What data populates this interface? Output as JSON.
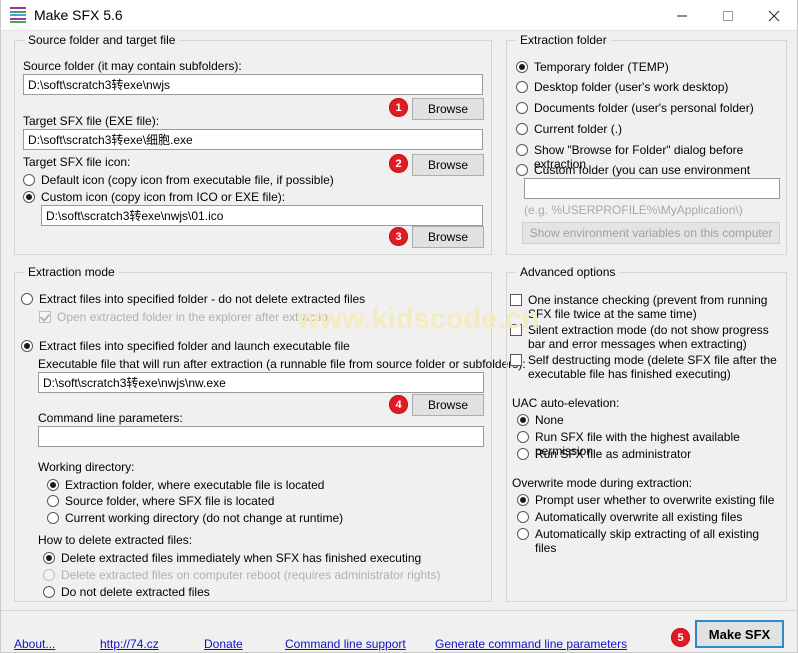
{
  "window": {
    "title": "Make SFX 5.6",
    "icon": "stacked-bars-icon",
    "minimize": "─",
    "maximize": "□",
    "close": "✕"
  },
  "source_group": {
    "legend": "Source folder and target file",
    "source_label": "Source folder (it may contain subfolders):",
    "source_value": "D:\\soft\\scratch3转exe\\nwjs",
    "browse1": "Browse",
    "target_label": "Target SFX file (EXE file):",
    "target_value": "D:\\soft\\scratch3转exe\\细胞.exe",
    "icon_label": "Target SFX file icon:",
    "browse2": "Browse",
    "default_icon_label": "Default icon (copy icon from executable file, if possible)",
    "default_icon_checked": false,
    "custom_icon_label": "Custom icon (copy icon from ICO or EXE file):",
    "custom_icon_checked": true,
    "custom_icon_value": "D:\\soft\\scratch3转exe\\nwjs\\01.ico",
    "browse3": "Browse"
  },
  "extraction_mode_group": {
    "legend": "Extraction mode",
    "opt_no_delete": "Extract files into specified folder - do not delete extracted files",
    "opt_no_delete_checked": false,
    "open_explorer_label": "Open extracted folder in the explorer after extraction",
    "open_explorer_checked": true,
    "open_explorer_disabled": true,
    "opt_launch": "Extract files into specified folder and launch executable file",
    "opt_launch_checked": true,
    "exe_label": "Executable file that will run after extraction (a runnable file from source folder or subfolders):",
    "exe_value": "D:\\soft\\scratch3转exe\\nwjs\\nw.exe",
    "browse4": "Browse",
    "cmdline_label": "Command line parameters:",
    "cmdline_value": "",
    "workdir_label": "Working directory:",
    "workdir_options": [
      {
        "label": "Extraction folder, where executable file is located",
        "checked": true
      },
      {
        "label": "Source folder, where SFX file is located",
        "checked": false
      },
      {
        "label": "Current working directory (do not change at runtime)",
        "checked": false
      }
    ],
    "delete_label": "How to delete extracted files:",
    "delete_options": [
      {
        "label": "Delete extracted files immediately when SFX has finished executing",
        "checked": true,
        "disabled": false
      },
      {
        "label": "Delete extracted files on computer reboot (requires administrator rights)",
        "checked": false,
        "disabled": true
      },
      {
        "label": "Do not delete extracted files",
        "checked": false,
        "disabled": false
      }
    ]
  },
  "extraction_folder_group": {
    "legend": "Extraction folder",
    "options": [
      {
        "label": "Temporary folder (TEMP)",
        "checked": true
      },
      {
        "label": "Desktop folder (user's work desktop)",
        "checked": false
      },
      {
        "label": "Documents folder (user's personal folder)",
        "checked": false
      },
      {
        "label": "Current folder (.)",
        "checked": false
      },
      {
        "label": "Show \"Browse for Folder\" dialog before extraction",
        "checked": false
      },
      {
        "label": "Custom folder (you can use environment variables):",
        "checked": false
      }
    ],
    "custom_value": "",
    "hint": "(e.g. %USERPROFILE%\\MyApplication\\)",
    "env_button": "Show environment variables on this computer",
    "env_button_disabled": true
  },
  "advanced_group": {
    "legend": "Advanced options",
    "checkboxes": [
      {
        "label": "One instance checking (prevent from running SFX file twice at the same time)",
        "checked": false
      },
      {
        "label": "Silent extraction mode (do not show progress bar and error messages when extracting)",
        "checked": false
      },
      {
        "label": "Self destructing mode (delete SFX file after the executable file has finished executing)",
        "checked": false
      }
    ],
    "uac_label": "UAC auto-elevation:",
    "uac_options": [
      {
        "label": "None",
        "checked": true
      },
      {
        "label": "Run SFX file with the highest available permission",
        "checked": false
      },
      {
        "label": "Run SFX file as administrator",
        "checked": false
      }
    ],
    "overwrite_label": "Overwrite mode during extraction:",
    "overwrite_options": [
      {
        "label": "Prompt user whether to overwrite existing file",
        "checked": true
      },
      {
        "label": "Automatically overwrite all existing files",
        "checked": false
      },
      {
        "label": "Automatically skip extracting of all existing files",
        "checked": false
      }
    ]
  },
  "footer": {
    "links": [
      "About...",
      "http://74.cz",
      "Donate",
      "Command line support",
      "Generate command line parameters"
    ],
    "make_button": "Make SFX"
  },
  "badges": [
    "1",
    "2",
    "3",
    "4",
    "5"
  ],
  "watermark": "www.kidscode.cn",
  "colors": {
    "badge": "#e01b24",
    "link": "#1111cc",
    "focus_border": "#2d89c8",
    "watermark": "#f2ecc0"
  }
}
